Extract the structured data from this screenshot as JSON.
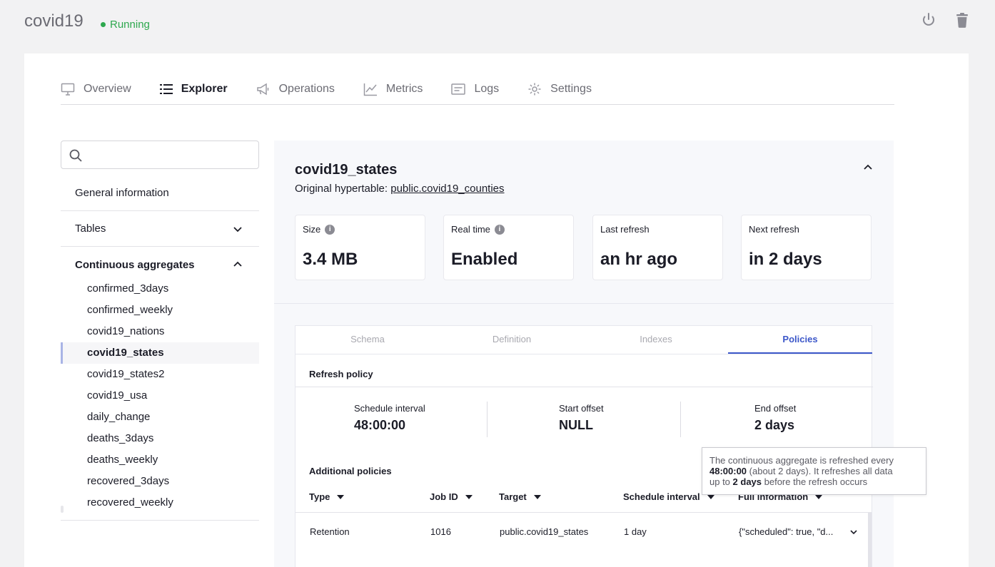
{
  "service": {
    "name": "covid19",
    "status": "Running"
  },
  "colors": {
    "accent": "#3c57c9",
    "status_green": "#2ea84e"
  },
  "nav_tabs": [
    {
      "label": "Overview",
      "icon": "monitor-icon"
    },
    {
      "label": "Explorer",
      "icon": "list-icon",
      "active": true
    },
    {
      "label": "Operations",
      "icon": "megaphone-icon"
    },
    {
      "label": "Metrics",
      "icon": "chart-icon"
    },
    {
      "label": "Logs",
      "icon": "logs-icon"
    },
    {
      "label": "Settings",
      "icon": "gear-icon"
    }
  ],
  "sidebar": {
    "search_placeholder": "",
    "general_info": "General information",
    "tables": "Tables",
    "continuous_aggregates": "Continuous aggregates",
    "aggregates": [
      "confirmed_3days",
      "confirmed_weekly",
      "covid19_nations",
      "covid19_states",
      "covid19_states2",
      "covid19_usa",
      "daily_change",
      "deaths_3days",
      "deaths_weekly",
      "recovered_3days",
      "recovered_weekly"
    ],
    "selected_aggregate": "covid19_states"
  },
  "detail": {
    "title": "covid19_states",
    "hypertable_label": "Original hypertable:",
    "hypertable_link": "public.covid19_counties",
    "stats": [
      {
        "label": "Size",
        "value": "3.4 MB",
        "info": true
      },
      {
        "label": "Real time",
        "value": "Enabled",
        "info": true
      },
      {
        "label": "Last refresh",
        "value": "an hr ago"
      },
      {
        "label": "Next refresh",
        "value": "in 2 days"
      }
    ],
    "tabs": [
      "Schema",
      "Definition",
      "Indexes",
      "Policies"
    ],
    "active_tab": "Policies",
    "refresh_policy": {
      "heading": "Refresh policy",
      "schedule_interval_label": "Schedule interval",
      "schedule_interval": "48:00:00",
      "start_offset_label": "Start offset",
      "start_offset": "NULL",
      "end_offset_label": "End offset",
      "end_offset": "2 days"
    },
    "additional_policies": {
      "heading": "Additional policies",
      "columns": [
        "Type",
        "Job ID",
        "Target",
        "Schedule interval",
        "Full information"
      ],
      "rows": [
        {
          "type": "Retention",
          "job_id": "1016",
          "target": "public.covid19_states",
          "schedule": "1 day",
          "full_info": "{\"scheduled\": true, \"d..."
        }
      ]
    }
  },
  "tooltip": {
    "t1": "The continuous aggregate is refreshed every",
    "t2": "48:00:00",
    "t3": " (about 2 days). It refreshes all data",
    "t4": "up to ",
    "t5": "2 days",
    "t6": " before the refresh occurs"
  }
}
